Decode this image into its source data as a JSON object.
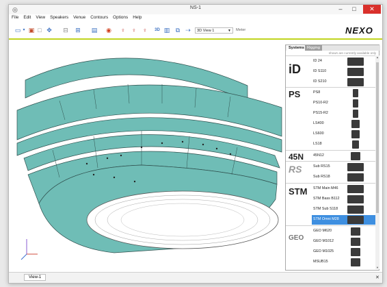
{
  "window": {
    "title": "NS-1",
    "min": "–",
    "max": "□",
    "close": "✕"
  },
  "menu": [
    "File",
    "Edit",
    "View",
    "Speakers",
    "Venue",
    "Contours",
    "Options",
    "Help"
  ],
  "toolbar": {
    "view_select": "3D View 1",
    "meter": "Meter",
    "logo": "NEXO"
  },
  "panel": {
    "tabs": [
      "Systems",
      "Rigging"
    ],
    "note": "shown are currently available only",
    "groups": [
      {
        "brand": "iD",
        "items": [
          "ID 24",
          "ID S110",
          "ID S210"
        ]
      },
      {
        "brand": "PS",
        "items": [
          "PS8",
          "PS10-R2",
          "PS15-R2",
          "LS400",
          "LS600",
          "LS18"
        ]
      },
      {
        "brand": "45N",
        "items": [
          "45N12"
        ]
      },
      {
        "brand": "RS",
        "items": [
          "Sub RS15",
          "Sub RS18"
        ]
      },
      {
        "brand": "STM",
        "items": [
          "STM Main M46",
          "STM Bass B112",
          "STM Sub S118",
          "STM Omni M28"
        ]
      },
      {
        "brand": "GEO",
        "items": [
          "GEO M620",
          "GEO M1012",
          "GEO M1025",
          "MSUB15"
        ]
      }
    ],
    "selected": "STM Omni M28"
  },
  "bottom": {
    "view_tab": "View-1",
    "close": "✕"
  }
}
